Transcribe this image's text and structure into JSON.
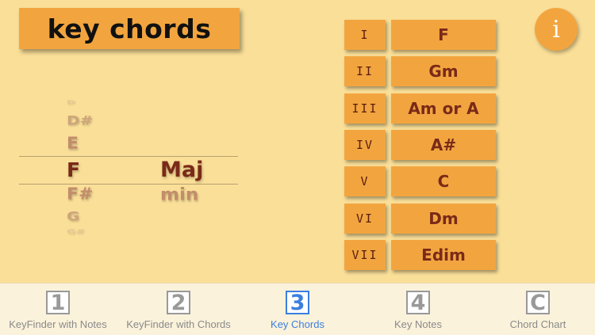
{
  "header": {
    "title": "key chords",
    "info_label": "i"
  },
  "picker": {
    "notes": [
      "D",
      "D#",
      "E",
      "F",
      "F#",
      "G",
      "G#"
    ],
    "selected_note": "F",
    "qualities": [
      "Maj",
      "min"
    ],
    "selected_quality": "Maj"
  },
  "degrees": [
    {
      "numeral": "I",
      "chord": "F"
    },
    {
      "numeral": "II",
      "chord": "Gm"
    },
    {
      "numeral": "III",
      "chord": "Am or A"
    },
    {
      "numeral": "IV",
      "chord": "A#"
    },
    {
      "numeral": "V",
      "chord": "C"
    },
    {
      "numeral": "VI",
      "chord": "Dm"
    },
    {
      "numeral": "VII",
      "chord": "Edim"
    }
  ],
  "tabs": [
    {
      "icon": "1",
      "label": "KeyFinder with Notes"
    },
    {
      "icon": "2",
      "label": "KeyFinder with Chords"
    },
    {
      "icon": "3",
      "label": "Key Chords",
      "active": true
    },
    {
      "icon": "4",
      "label": "Key Notes"
    },
    {
      "icon": "C",
      "label": "Chord Chart"
    }
  ],
  "colors": {
    "background": "#FADF98",
    "button": "#F2A53F",
    "chord_text": "#7A2A18",
    "tab_active": "#3B7FE0",
    "tab_inactive": "#999999"
  }
}
